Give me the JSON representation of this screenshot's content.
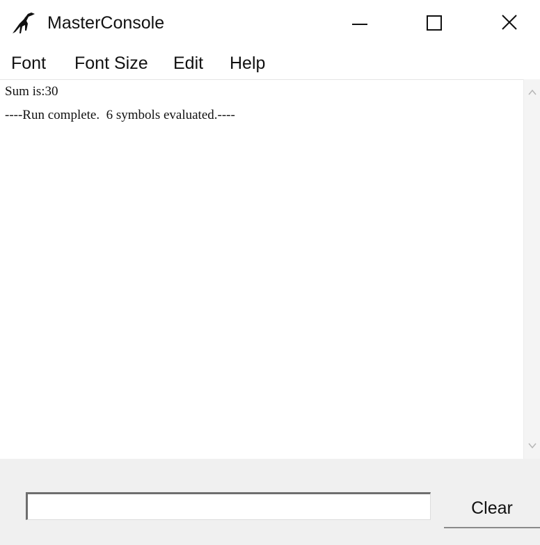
{
  "window": {
    "title": "MasterConsole",
    "app_icon": "dinosaur-icon",
    "controls": {
      "minimize_icon": "minimize-icon",
      "maximize_icon": "maximize-icon",
      "close_icon": "close-icon"
    }
  },
  "menubar": {
    "items": [
      {
        "label": "Font"
      },
      {
        "label": "Font Size"
      },
      {
        "label": "Edit"
      },
      {
        "label": "Help"
      }
    ]
  },
  "console": {
    "lines": [
      "Sum is:30",
      "----Run complete.  6 symbols evaluated.----"
    ]
  },
  "scrollbar": {
    "up_icon": "chevron-up-icon",
    "down_icon": "chevron-down-icon"
  },
  "input": {
    "value": "",
    "placeholder": ""
  },
  "clear_button": {
    "label": "Clear"
  },
  "colors": {
    "panel_background": "#f0f0f0",
    "text": "#111111",
    "window_background": "#ffffff"
  }
}
